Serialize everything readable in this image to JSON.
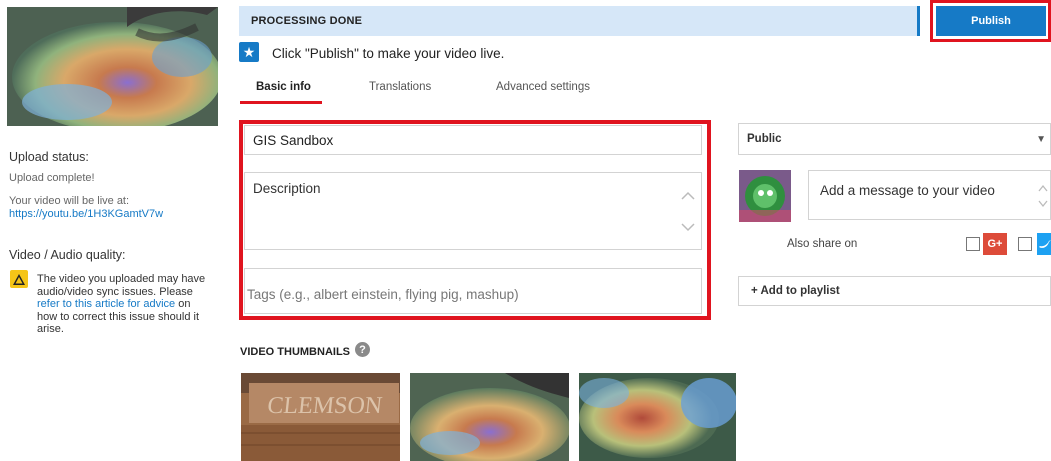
{
  "left": {
    "upload_status_title": "Upload status:",
    "upload_complete": "Upload complete!",
    "live_at": "Your video will be live at:",
    "video_url": "https://youtu.be/1H3KGamtV7w",
    "quality_title": "Video / Audio quality:",
    "warning_text_1": "The video you uploaded may have audio/video sync issues. Please ",
    "warning_link": "refer to this article for advice",
    "warning_text_2": " on how to correct this issue should it arise."
  },
  "header": {
    "status": "PROCESSING DONE",
    "publish_label": "Publish",
    "hint": "Click \"Publish\" to make your video live."
  },
  "tabs": [
    {
      "label": "Basic info",
      "active": true
    },
    {
      "label": "Translations",
      "active": false
    },
    {
      "label": "Advanced settings",
      "active": false
    }
  ],
  "form": {
    "title_value": "GIS Sandbox",
    "description_placeholder": "Description",
    "tags_placeholder": "Tags (e.g., albert einstein, flying pig, mashup)"
  },
  "right": {
    "privacy_value": "Public",
    "message_placeholder": "Add a message to your video",
    "share_label": "Also share on",
    "gplus_label": "G+",
    "playlist_label": "+ Add to playlist"
  },
  "thumbnails": {
    "title": "VIDEO THUMBNAILS",
    "help": "?"
  },
  "icons": {
    "star": "star-icon",
    "warning": "warning-icon",
    "help": "help-icon",
    "caret": "caret-down-icon",
    "chevron_up": "chevron-up-icon",
    "chevron_down": "chevron-down-icon",
    "twitter": "twitter-icon"
  },
  "colors": {
    "accent": "#167ac6",
    "highlight": "#e0141f",
    "processing_bg": "#d6e7f8",
    "warning": "#f5c518",
    "gplus": "#dd4b39",
    "twitter": "#1da1f2"
  }
}
